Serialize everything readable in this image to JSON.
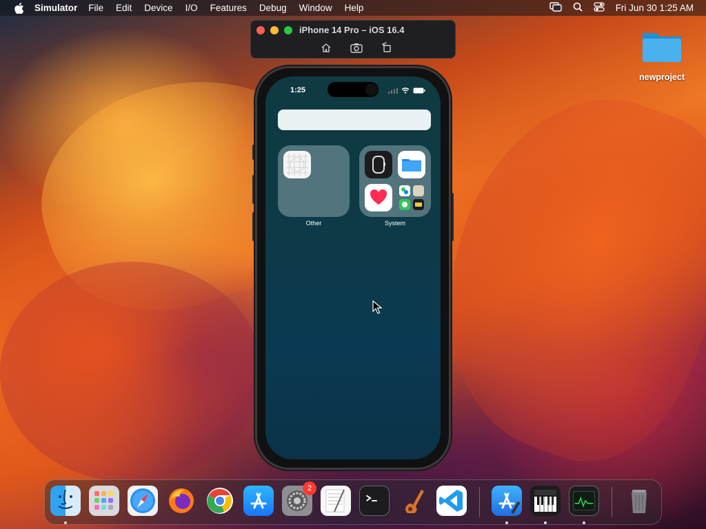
{
  "menubar": {
    "app_name": "Simulator",
    "items": [
      "File",
      "Edit",
      "Device",
      "I/O",
      "Features",
      "Debug",
      "Window",
      "Help"
    ],
    "clock": "Fri Jun 30  1:25 AM"
  },
  "simulator_window": {
    "title": "iPhone 14 Pro – iOS 16.4"
  },
  "phone": {
    "status_time": "1:25",
    "folders": [
      {
        "label": "Other"
      },
      {
        "label": " System"
      }
    ]
  },
  "desktop": {
    "folder_label": "newproject"
  },
  "dock": {
    "settings_badge": "2"
  },
  "colors": {
    "menubar_text": "#ffffff",
    "badge": "#ff3b30",
    "folder_blue": "#3aa3e0"
  }
}
